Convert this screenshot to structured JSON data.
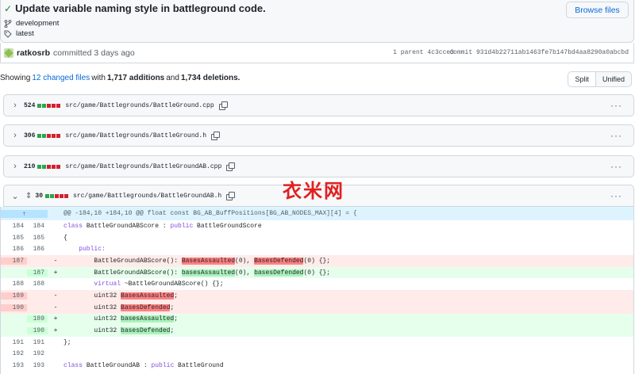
{
  "commit": {
    "title": "Update variable naming style in battleground code.",
    "browse_label": "Browse files",
    "branch": "development",
    "tag": "latest",
    "author": "ratkosrb",
    "committed": "committed 3 days ago",
    "parent_label": "1 parent",
    "parent_hash": "4c3cce3",
    "commit_label": "commit",
    "commit_hash": "931d4b22711ab1463fe7b147bd4aa8290a0abcbd"
  },
  "summary": {
    "prefix": "Showing",
    "changed": "12 changed files",
    "with": "with",
    "additions": "1,717 additions",
    "and": "and",
    "deletions": "1,734 deletions."
  },
  "view_toggle": {
    "split": "Split",
    "unified": "Unified"
  },
  "files": [
    {
      "count": "524",
      "path": "src/game/Battlegrounds/BattleGround.cpp",
      "blocks": [
        "g",
        "g",
        "r",
        "r",
        "r"
      ]
    },
    {
      "count": "306",
      "path": "src/game/Battlegrounds/BattleGround.h",
      "blocks": [
        "g",
        "g",
        "r",
        "r",
        "r"
      ]
    },
    {
      "count": "210",
      "path": "src/game/Battlegrounds/BattleGroundAB.cpp",
      "blocks": [
        "g",
        "g",
        "r",
        "r",
        "r"
      ]
    },
    {
      "count": "30",
      "path": "src/game/Battlegrounds/BattleGroundAB.h",
      "blocks": [
        "g",
        "g",
        "r",
        "r",
        "r"
      ]
    }
  ],
  "hunk_header": "@@ -184,10 +184,10 @@ float const BG_AB_BuffPositions[BG_AB_NODES_MAX][4] = {",
  "diff_lines": [
    {
      "type": "ctx",
      "old": "184",
      "new": "184",
      "sign": "",
      "code": "class BattleGroundABScore : public BattleGroundScore"
    },
    {
      "type": "ctx",
      "old": "185",
      "new": "185",
      "sign": "",
      "code": "{"
    },
    {
      "type": "ctx",
      "old": "186",
      "new": "186",
      "sign": "",
      "code": "    public:"
    },
    {
      "type": "del",
      "old": "187",
      "new": "",
      "sign": "-",
      "code": "        BattleGroundABScore(): BasesAssaulted(0), BasesDefended(0) {};"
    },
    {
      "type": "add",
      "old": "",
      "new": "187",
      "sign": "+",
      "code": "        BattleGroundABScore(): basesAssaulted(0), basesDefended(0) {};"
    },
    {
      "type": "ctx",
      "old": "188",
      "new": "188",
      "sign": "",
      "code": "        virtual ~BattleGroundABScore() {};"
    },
    {
      "type": "del",
      "old": "189",
      "new": "",
      "sign": "-",
      "code": "        uint32 BasesAssaulted;"
    },
    {
      "type": "del",
      "old": "190",
      "new": "",
      "sign": "-",
      "code": "        uint32 BasesDefended;"
    },
    {
      "type": "add",
      "old": "",
      "new": "189",
      "sign": "+",
      "code": "        uint32 basesAssaulted;"
    },
    {
      "type": "add",
      "old": "",
      "new": "190",
      "sign": "+",
      "code": "        uint32 basesDefended;"
    },
    {
      "type": "ctx",
      "old": "191",
      "new": "191",
      "sign": "",
      "code": "};"
    },
    {
      "type": "ctx",
      "old": "192",
      "new": "192",
      "sign": "",
      "code": ""
    },
    {
      "type": "ctx",
      "old": "193",
      "new": "193",
      "sign": "",
      "code": "class BattleGroundAB : public BattleGround"
    }
  ],
  "watermark": "衣米网",
  "colors": {
    "add": "#2da44e",
    "del": "#cf222e",
    "link": "#0969da"
  }
}
